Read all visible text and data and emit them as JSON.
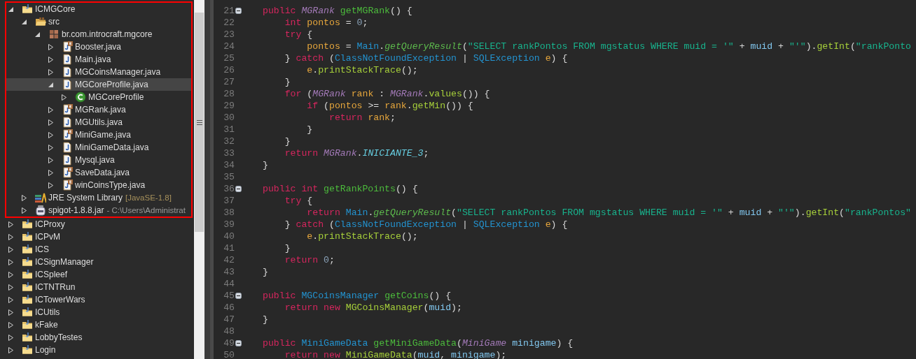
{
  "explorer": {
    "items": [
      {
        "label": "ICMGCore",
        "kind": "project",
        "expanded": true,
        "selected": false,
        "outlined": true,
        "children": [
          {
            "label": "src",
            "kind": "source-folder",
            "expanded": true,
            "selected": false,
            "children": [
              {
                "label": "br.com.introcraft.mgcore",
                "kind": "package",
                "expanded": true,
                "selected": false,
                "children": [
                  {
                    "label": "Booster.java",
                    "kind": "enum-file",
                    "expanded": false,
                    "selected": false
                  },
                  {
                    "label": "Main.java",
                    "kind": "java-file",
                    "expanded": false,
                    "selected": false
                  },
                  {
                    "label": "MGCoinsManager.java",
                    "kind": "java-file",
                    "expanded": false,
                    "selected": false
                  },
                  {
                    "label": "MGCoreProfile.java",
                    "kind": "java-file",
                    "expanded": true,
                    "selected": true,
                    "children": [
                      {
                        "label": "MGCoreProfile",
                        "kind": "class",
                        "expanded": false,
                        "selected": false
                      }
                    ]
                  },
                  {
                    "label": "MGRank.java",
                    "kind": "enum-file",
                    "expanded": false,
                    "selected": false
                  },
                  {
                    "label": "MGUtils.java",
                    "kind": "java-file",
                    "expanded": false,
                    "selected": false
                  },
                  {
                    "label": "MiniGame.java",
                    "kind": "enum-file",
                    "expanded": false,
                    "selected": false
                  },
                  {
                    "label": "MiniGameData.java",
                    "kind": "java-file",
                    "expanded": false,
                    "selected": false
                  },
                  {
                    "label": "Mysql.java",
                    "kind": "java-file",
                    "expanded": false,
                    "selected": false
                  },
                  {
                    "label": "SaveData.java",
                    "kind": "enum-file",
                    "expanded": false,
                    "selected": false
                  },
                  {
                    "label": "winCoinsType.java",
                    "kind": "enum-file",
                    "expanded": false,
                    "selected": false
                  }
                ]
              }
            ]
          },
          {
            "label": "JRE System Library",
            "decoration": "[JavaSE-1.8]",
            "kind": "library",
            "expanded": false,
            "selected": false
          },
          {
            "label": "spigot-1.8.8.jar",
            "decoration": "- C:\\Users\\Administrat",
            "kind": "jar",
            "expanded": false,
            "selected": false
          }
        ]
      },
      {
        "label": "ICProxy",
        "kind": "project",
        "expanded": false,
        "selected": false,
        "outlined": false
      },
      {
        "label": "ICPvM",
        "kind": "project",
        "expanded": false,
        "selected": false,
        "outlined": false
      },
      {
        "label": "ICS",
        "kind": "project",
        "expanded": false,
        "selected": false,
        "outlined": false
      },
      {
        "label": "ICSignManager",
        "kind": "project",
        "expanded": false,
        "selected": false,
        "outlined": false
      },
      {
        "label": "ICSpleef",
        "kind": "project",
        "expanded": false,
        "selected": false,
        "outlined": false
      },
      {
        "label": "ICTNTRun",
        "kind": "project",
        "expanded": false,
        "selected": false,
        "outlined": false
      },
      {
        "label": "ICTowerWars",
        "kind": "project",
        "expanded": false,
        "selected": false,
        "outlined": false
      },
      {
        "label": "ICUtils",
        "kind": "project",
        "expanded": false,
        "selected": false,
        "outlined": false
      },
      {
        "label": "kFake",
        "kind": "project",
        "expanded": false,
        "selected": false,
        "outlined": false
      },
      {
        "label": "LobbyTestes",
        "kind": "project",
        "expanded": false,
        "selected": false,
        "outlined": false
      },
      {
        "label": "Login",
        "kind": "project",
        "expanded": false,
        "selected": false,
        "outlined": false
      }
    ]
  },
  "editor": {
    "lines": [
      {
        "number": "21",
        "fold": true,
        "tokens": [
          {
            "kind": "kw",
            "text": "public "
          },
          {
            "kind": "type",
            "text": "MGRank "
          },
          {
            "kind": "decl",
            "text": "getMGRank"
          },
          {
            "kind": "plain",
            "text": "() {"
          }
        ]
      },
      {
        "number": "22",
        "tokens": [
          {
            "kind": "kw",
            "text": "    int "
          },
          {
            "kind": "var",
            "text": "pontos"
          },
          {
            "kind": "plain",
            "text": " = "
          },
          {
            "kind": "num",
            "text": "0"
          },
          {
            "kind": "plain",
            "text": ";"
          }
        ]
      },
      {
        "number": "23",
        "tokens": [
          {
            "kind": "kw",
            "text": "    try "
          },
          {
            "kind": "plain",
            "text": "{"
          }
        ]
      },
      {
        "number": "24",
        "tokens": [
          {
            "kind": "var",
            "text": "        pontos"
          },
          {
            "kind": "plain",
            "text": " = "
          },
          {
            "kind": "cls",
            "text": "Main"
          },
          {
            "kind": "plain",
            "text": "."
          },
          {
            "kind": "smethod",
            "text": "getQueryResult"
          },
          {
            "kind": "plain",
            "text": "("
          },
          {
            "kind": "str",
            "text": "\"SELECT rankPontos FROM mgstatus WHERE muid = '\""
          },
          {
            "kind": "plain",
            "text": " + "
          },
          {
            "kind": "field",
            "text": "muid"
          },
          {
            "kind": "plain",
            "text": " + "
          },
          {
            "kind": "str",
            "text": "\"'\""
          },
          {
            "kind": "plain",
            "text": ")."
          },
          {
            "kind": "call",
            "text": "getInt"
          },
          {
            "kind": "plain",
            "text": "("
          },
          {
            "kind": "str",
            "text": "\"rankPonto"
          }
        ]
      },
      {
        "number": "25",
        "tokens": [
          {
            "kind": "plain",
            "text": "    } "
          },
          {
            "kind": "kw",
            "text": "catch "
          },
          {
            "kind": "plain",
            "text": "("
          },
          {
            "kind": "cls",
            "text": "ClassNotFoundException"
          },
          {
            "kind": "plain",
            "text": " | "
          },
          {
            "kind": "cls",
            "text": "SQLException "
          },
          {
            "kind": "var",
            "text": "e"
          },
          {
            "kind": "plain",
            "text": ") {"
          }
        ]
      },
      {
        "number": "26",
        "tokens": [
          {
            "kind": "var",
            "text": "        e"
          },
          {
            "kind": "plain",
            "text": "."
          },
          {
            "kind": "call",
            "text": "printStackTrace"
          },
          {
            "kind": "plain",
            "text": "();"
          }
        ]
      },
      {
        "number": "27",
        "tokens": [
          {
            "kind": "plain",
            "text": "    }"
          }
        ]
      },
      {
        "number": "28",
        "tokens": [
          {
            "kind": "kw",
            "text": "    for "
          },
          {
            "kind": "plain",
            "text": "("
          },
          {
            "kind": "type",
            "text": "MGRank "
          },
          {
            "kind": "var",
            "text": "rank"
          },
          {
            "kind": "plain",
            "text": " : "
          },
          {
            "kind": "type",
            "text": "MGRank"
          },
          {
            "kind": "plain",
            "text": "."
          },
          {
            "kind": "call",
            "text": "values"
          },
          {
            "kind": "plain",
            "text": "()) {"
          }
        ]
      },
      {
        "number": "29",
        "tokens": [
          {
            "kind": "kw",
            "text": "        if "
          },
          {
            "kind": "plain",
            "text": "("
          },
          {
            "kind": "var",
            "text": "pontos"
          },
          {
            "kind": "plain",
            "text": " >= "
          },
          {
            "kind": "var",
            "text": "rank"
          },
          {
            "kind": "plain",
            "text": "."
          },
          {
            "kind": "call",
            "text": "getMin"
          },
          {
            "kind": "plain",
            "text": "()) {"
          }
        ]
      },
      {
        "number": "30",
        "tokens": [
          {
            "kind": "kw",
            "text": "            return "
          },
          {
            "kind": "var",
            "text": "rank"
          },
          {
            "kind": "plain",
            "text": ";"
          }
        ]
      },
      {
        "number": "31",
        "tokens": [
          {
            "kind": "plain",
            "text": "        }"
          }
        ]
      },
      {
        "number": "32",
        "tokens": [
          {
            "kind": "plain",
            "text": "    }"
          }
        ]
      },
      {
        "number": "33",
        "tokens": [
          {
            "kind": "kw",
            "text": "    return "
          },
          {
            "kind": "type",
            "text": "MGRank"
          },
          {
            "kind": "plain",
            "text": "."
          },
          {
            "kind": "const",
            "text": "INICIANTE_3"
          },
          {
            "kind": "plain",
            "text": ";"
          }
        ]
      },
      {
        "number": "34",
        "tokens": [
          {
            "kind": "plain",
            "text": "}"
          }
        ]
      },
      {
        "number": "35"
      },
      {
        "number": "36",
        "fold": true,
        "tokens": [
          {
            "kind": "kw",
            "text": "public "
          },
          {
            "kind": "kw",
            "text": "int "
          },
          {
            "kind": "decl",
            "text": "getRankPoints"
          },
          {
            "kind": "plain",
            "text": "() {"
          }
        ]
      },
      {
        "number": "37",
        "tokens": [
          {
            "kind": "kw",
            "text": "    try "
          },
          {
            "kind": "plain",
            "text": "{"
          }
        ]
      },
      {
        "number": "38",
        "tokens": [
          {
            "kind": "kw",
            "text": "        return "
          },
          {
            "kind": "cls",
            "text": "Main"
          },
          {
            "kind": "plain",
            "text": "."
          },
          {
            "kind": "smethod",
            "text": "getQueryResult"
          },
          {
            "kind": "plain",
            "text": "("
          },
          {
            "kind": "str",
            "text": "\"SELECT rankPontos FROM mgstatus WHERE muid = '\""
          },
          {
            "kind": "plain",
            "text": " + "
          },
          {
            "kind": "field",
            "text": "muid"
          },
          {
            "kind": "plain",
            "text": " + "
          },
          {
            "kind": "str",
            "text": "\"'\""
          },
          {
            "kind": "plain",
            "text": ")."
          },
          {
            "kind": "call",
            "text": "getInt"
          },
          {
            "kind": "plain",
            "text": "("
          },
          {
            "kind": "str",
            "text": "\"rankPontos\""
          }
        ]
      },
      {
        "number": "39",
        "tokens": [
          {
            "kind": "plain",
            "text": "    } "
          },
          {
            "kind": "kw",
            "text": "catch "
          },
          {
            "kind": "plain",
            "text": "("
          },
          {
            "kind": "cls",
            "text": "ClassNotFoundException"
          },
          {
            "kind": "plain",
            "text": " | "
          },
          {
            "kind": "cls",
            "text": "SQLException "
          },
          {
            "kind": "var",
            "text": "e"
          },
          {
            "kind": "plain",
            "text": ") {"
          }
        ]
      },
      {
        "number": "40",
        "tokens": [
          {
            "kind": "var",
            "text": "        e"
          },
          {
            "kind": "plain",
            "text": "."
          },
          {
            "kind": "call",
            "text": "printStackTrace"
          },
          {
            "kind": "plain",
            "text": "();"
          }
        ]
      },
      {
        "number": "41",
        "tokens": [
          {
            "kind": "plain",
            "text": "    }"
          }
        ]
      },
      {
        "number": "42",
        "tokens": [
          {
            "kind": "kw",
            "text": "    return "
          },
          {
            "kind": "num",
            "text": "0"
          },
          {
            "kind": "plain",
            "text": ";"
          }
        ]
      },
      {
        "number": "43",
        "tokens": [
          {
            "kind": "plain",
            "text": "}"
          }
        ]
      },
      {
        "number": "44"
      },
      {
        "number": "45",
        "fold": true,
        "tokens": [
          {
            "kind": "kw",
            "text": "public "
          },
          {
            "kind": "cls",
            "text": "MGCoinsManager "
          },
          {
            "kind": "decl",
            "text": "getCoins"
          },
          {
            "kind": "plain",
            "text": "() {"
          }
        ]
      },
      {
        "number": "46",
        "tokens": [
          {
            "kind": "kw",
            "text": "    return "
          },
          {
            "kind": "kw",
            "text": "new "
          },
          {
            "kind": "call",
            "text": "MGCoinsManager"
          },
          {
            "kind": "plain",
            "text": "("
          },
          {
            "kind": "field",
            "text": "muid"
          },
          {
            "kind": "plain",
            "text": ");"
          }
        ]
      },
      {
        "number": "47",
        "tokens": [
          {
            "kind": "plain",
            "text": "}"
          }
        ]
      },
      {
        "number": "48"
      },
      {
        "number": "49",
        "fold": true,
        "tokens": [
          {
            "kind": "kw",
            "text": "public "
          },
          {
            "kind": "cls",
            "text": "MiniGameData "
          },
          {
            "kind": "decl",
            "text": "getMiniGameData"
          },
          {
            "kind": "plain",
            "text": "("
          },
          {
            "kind": "type",
            "text": "MiniGame "
          },
          {
            "kind": "field",
            "text": "minigame"
          },
          {
            "kind": "plain",
            "text": ") {"
          }
        ]
      },
      {
        "number": "50",
        "tokens": [
          {
            "kind": "kw",
            "text": "    return "
          },
          {
            "kind": "kw",
            "text": "new "
          },
          {
            "kind": "call",
            "text": "MiniGameData"
          },
          {
            "kind": "plain",
            "text": "("
          },
          {
            "kind": "field",
            "text": "muid"
          },
          {
            "kind": "plain",
            "text": ", "
          },
          {
            "kind": "field",
            "text": "minigame"
          },
          {
            "kind": "plain",
            "text": ");"
          }
        ]
      }
    ]
  }
}
